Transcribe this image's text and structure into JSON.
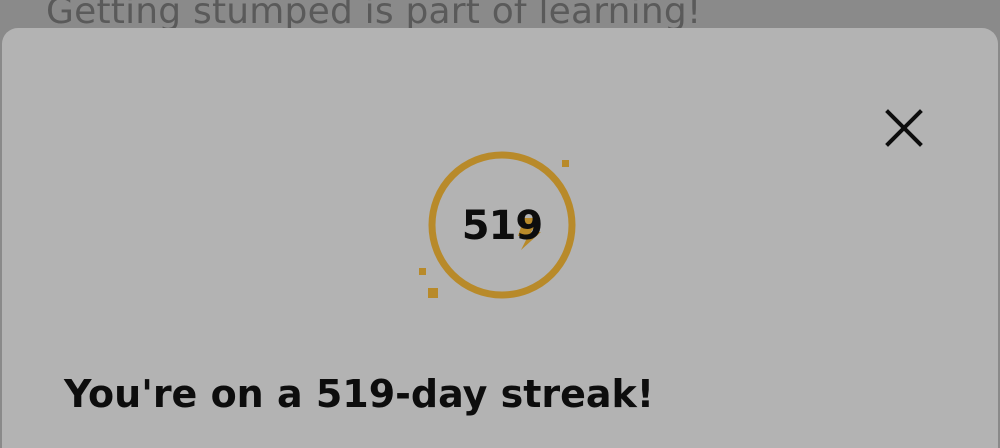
{
  "background": {
    "text": "Getting stumped is part of learning!"
  },
  "modal": {
    "close_icon": "close-icon",
    "streak": {
      "count": "519",
      "icon": "lightning-bolt-icon",
      "accent_color": "#b88a2a"
    },
    "headline": "You're on a 519-day streak!"
  },
  "colors": {
    "overlay": "#8a8a8a",
    "sheet": "#b3b3b3",
    "text": "#0d0d0d"
  }
}
